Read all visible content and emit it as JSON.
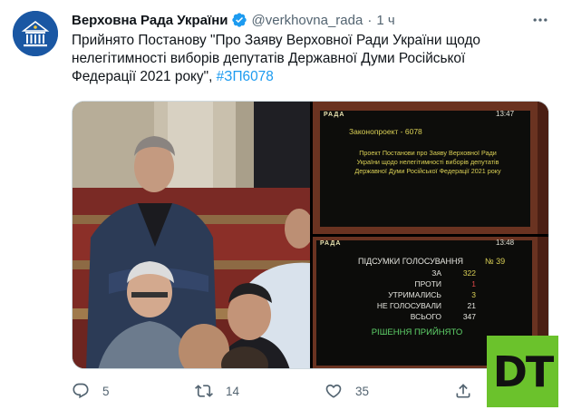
{
  "tweet": {
    "author_name": "Верховна Рада України",
    "handle": "@verkhovna_rada",
    "separator": "·",
    "time": "1 ч",
    "text": "Прийнято Постанову \"Про Заяву Верховної Ради України щодо нелегітимності виборів депутатів Державної Думи Російської Федерації 2021 року\", ",
    "hashtag": "#ЗП6078"
  },
  "screen_top": {
    "brand": "РАДА",
    "clock": "13:47",
    "title": "Законопроект - 6078",
    "body_lines": [
      "Проект Постанови про Заяву Верховної Ради",
      "України щодо нелегітимності виборів депутатів",
      "Державної Думи Російської Федерації 2021 року"
    ]
  },
  "screen_bottom": {
    "brand": "РАДА",
    "clock": "13:48",
    "heading": "ПІДСУМКИ ГОЛОСУВАННЯ",
    "number": "№ 39",
    "rows": [
      {
        "label": "ЗА",
        "value": "322"
      },
      {
        "label": "ПРОТИ",
        "value": "1"
      },
      {
        "label": "УТРИМАЛИСЬ",
        "value": "3"
      },
      {
        "label": "НЕ ГОЛОСУВАЛИ",
        "value": "21"
      },
      {
        "label": "ВСЬОГО",
        "value": "347"
      }
    ],
    "result": "РІШЕННЯ ПРИЙНЯТО"
  },
  "actions": {
    "replies": "5",
    "retweets": "14",
    "likes": "35"
  },
  "watermark": "DT",
  "colors": {
    "link": "#1d9bf0",
    "verified": "#1d9bf0",
    "muted": "#536471",
    "screen_green": "#c8c84a",
    "watermark_bg": "#6bc22c"
  },
  "icons": [
    "verified-badge-icon",
    "more-icon",
    "reply-icon",
    "retweet-icon",
    "like-icon",
    "share-icon"
  ]
}
